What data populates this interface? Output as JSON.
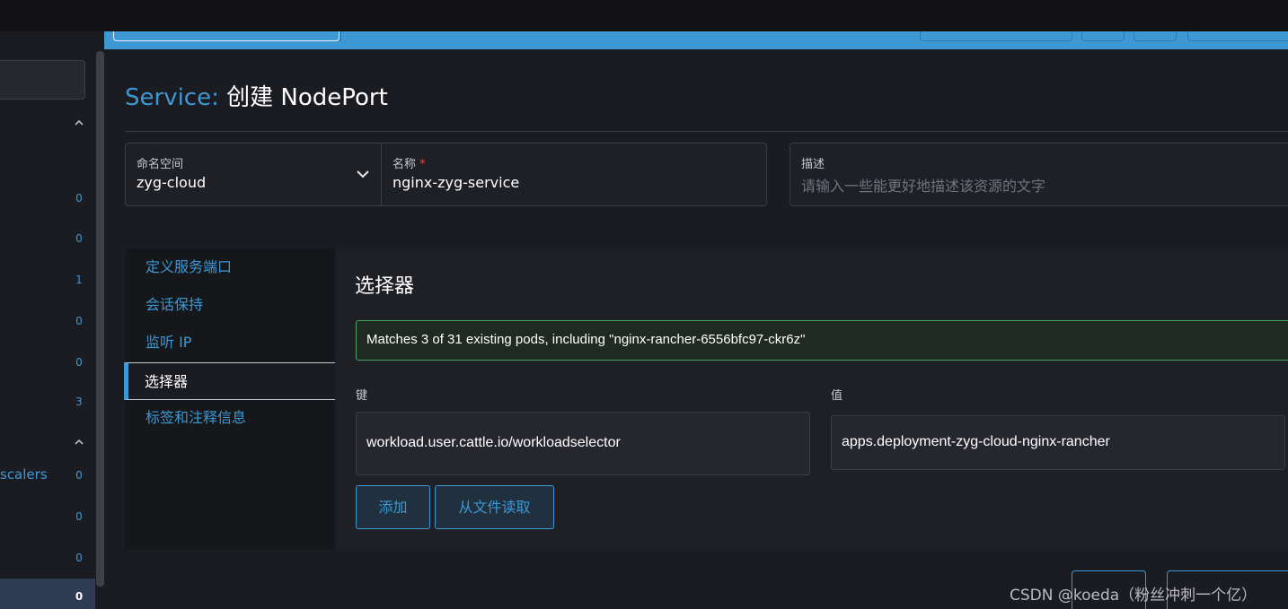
{
  "sidebar": {
    "counts": [
      "0",
      "0",
      "1",
      "0",
      "0",
      "3",
      "0",
      "0",
      "0"
    ],
    "scalers_label": "scalers",
    "active_count": "0"
  },
  "header": {
    "kind": "Service:",
    "title": "创建 NodePort"
  },
  "form": {
    "namespace": {
      "label": "命名空间",
      "value": "zyg-cloud"
    },
    "name": {
      "label": "名称",
      "required": "*",
      "value": "nginx-zyg-service"
    },
    "description": {
      "label": "描述",
      "placeholder": "请输入一些能更好地描述该资源的文字"
    }
  },
  "tabs": [
    {
      "label": "定义服务端口"
    },
    {
      "label": "会话保持"
    },
    {
      "label": "监听 IP"
    },
    {
      "label": "选择器"
    },
    {
      "label": "标签和注释信息"
    }
  ],
  "selector": {
    "title": "选择器",
    "banner": "Matches 3 of 31 existing pods, including \"nginx-rancher-6556bfc97-ckr6z\"",
    "key_label": "键",
    "value_label": "值",
    "key": "workload.user.cattle.io/workloadselector",
    "value": "apps.deployment-zyg-cloud-nginx-rancher",
    "add_button": "添加",
    "read_file_button": "从文件读取"
  },
  "watermark": "CSDN @koeda（粉丝冲刺一个亿）",
  "colors": {
    "accent": "#3d98d3",
    "success_border": "#4aa35c",
    "required": "#e24c4b"
  }
}
